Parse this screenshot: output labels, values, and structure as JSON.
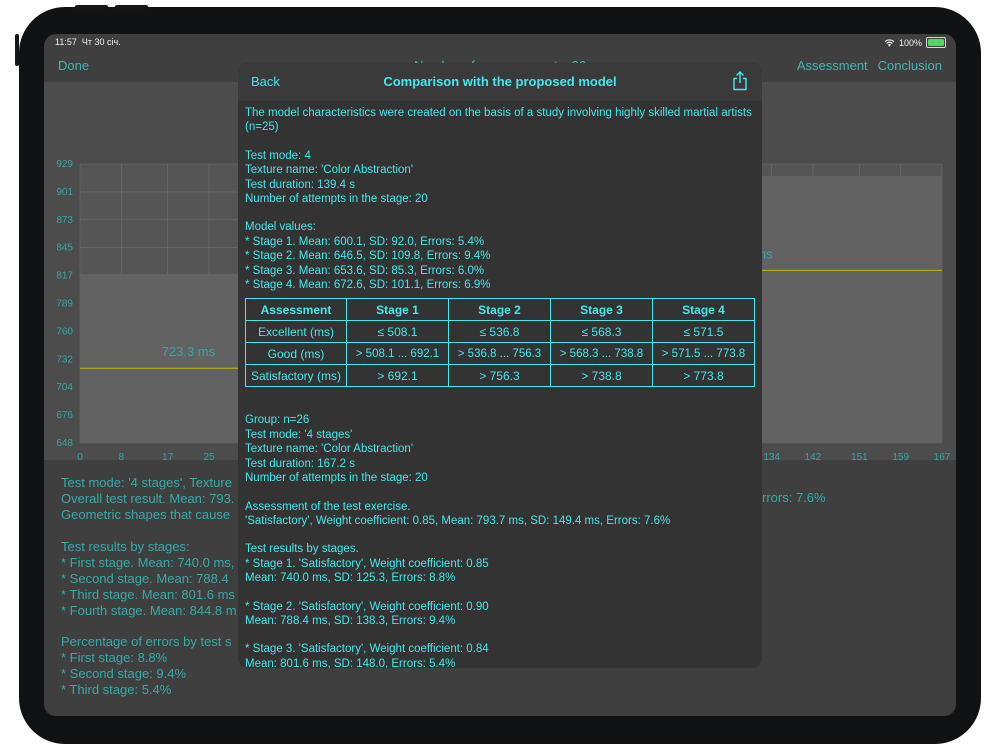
{
  "status": {
    "time": "11:57",
    "date": "Чт 30 січ.",
    "battery": "100%"
  },
  "nav": {
    "done": "Done",
    "title": "Number of measurements: 26",
    "assessment": "Assessment",
    "conclusion": "Conclusion"
  },
  "chart": {
    "y_ticks": [
      "929",
      "901",
      "873",
      "845",
      "817",
      "789",
      "760",
      "732",
      "704",
      "676",
      "648"
    ],
    "x_ticks_left": [
      "0",
      "8",
      "17",
      "25"
    ],
    "x_ticks_right": [
      "134",
      "142",
      "151",
      "159",
      "167"
    ],
    "left_label": "723.3 ms",
    "right_label": "821.9 ms"
  },
  "chart_data": {
    "type": "bar",
    "categories": [
      "",
      ""
    ],
    "values": [
      723.3,
      821.9
    ],
    "ylim": [
      648,
      929
    ],
    "xlim": [
      0,
      167
    ],
    "data_labels": [
      "723.3 ms",
      "821.9 ms"
    ]
  },
  "background_text": {
    "line1": "Test mode: '4 stages', Texture",
    "line2": "Overall test result. Mean: 793.",
    "line3": "Geometric shapes that cause",
    "stages_title": "Test results by stages:",
    "s1": "* First stage. Mean: 740.0 ms,",
    "s2": "* Second stage. Mean: 788.4",
    "s3": "* Third stage. Mean: 801.6 ms",
    "s4": "* Fourth stage. Mean: 844.8 m",
    "err_title": "Percentage of errors by test s",
    "e1": "* First stage: 8.8%",
    "e2": "* Second stage: 9.4%",
    "e3": "* Third stage: 5.4%",
    "right_err": "rrors: 7.6%"
  },
  "modal": {
    "back": "Back",
    "title": "Comparison with the proposed model",
    "intro": "The model characteristics were created on the basis of a study involving highly skilled martial artists (n=25)",
    "test_mode": "Test mode: 4",
    "texture": "Texture name: 'Color Abstraction'",
    "duration": "Test duration: 139.4 s",
    "attempts": "Number of attempts in the stage: 20",
    "model_values_title": "Model values:",
    "model_values": [
      "* Stage 1. Mean: 600.1, SD: 92.0, Errors: 5.4%",
      "* Stage 2. Mean: 646.5, SD: 109.8, Errors: 9.4%",
      "* Stage 3. Mean: 653.6, SD: 85.3, Errors: 6.0%",
      "* Stage 4. Mean: 672.6, SD: 101.1, Errors: 6.9%"
    ],
    "table": {
      "headers": [
        "Assessment",
        "Stage 1",
        "Stage 2",
        "Stage 3",
        "Stage 4"
      ],
      "rows": [
        [
          "Excellent (ms)",
          "≤ 508.1",
          "≤ 536.8",
          "≤ 568.3",
          "≤ 571.5"
        ],
        [
          "Good (ms)",
          "> 508.1 ... 692.1",
          "> 536.8 ... 756.3",
          "> 568.3 ... 738.8",
          "> 571.5 ... 773.8"
        ],
        [
          "Satisfactory (ms)",
          "> 692.1",
          "> 756.3",
          "> 738.8",
          "> 773.8"
        ]
      ]
    },
    "group": "Group: n=26",
    "group_mode": "Test mode: '4 stages'",
    "group_texture": "Texture name: 'Color Abstraction'",
    "group_duration": "Test duration: 167.2 s",
    "group_attempts": "Number of attempts in the stage: 20",
    "assess_title": "Assessment of the test exercise.",
    "assess_value": "'Satisfactory', Weight coefficient: 0.85, Mean: 793.7 ms, SD: 149.4 ms, Errors: 7.6%",
    "stages_title": "Test results by stages.",
    "stage1_a": "* Stage 1. 'Satisfactory', Weight coefficient: 0.85",
    "stage1_b": "Mean: 740.0 ms, SD: 125.3, Errors: 8.8%",
    "stage2_a": "* Stage 2. 'Satisfactory', Weight coefficient: 0.90",
    "stage2_b": "Mean: 788.4 ms, SD: 138.3, Errors: 9.4%",
    "stage3_a": "* Stage 3. 'Satisfactory', Weight coefficient: 0.84",
    "stage3_b": "Mean: 801.6 ms, SD: 148.0, Errors: 5.4%"
  }
}
